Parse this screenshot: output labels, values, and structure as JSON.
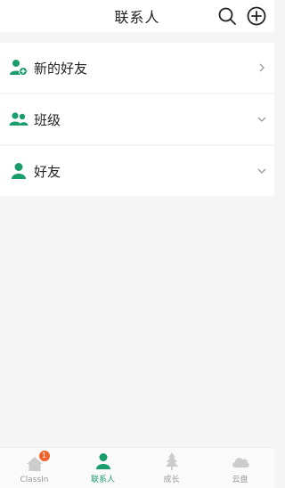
{
  "header": {
    "title": "联系人",
    "search_icon": "search-icon",
    "add_icon": "plus-circle-icon"
  },
  "rows": [
    {
      "label": "新的好友",
      "icon": "add-user-icon",
      "arrow": "chevron-right-icon"
    },
    {
      "label": "班级",
      "icon": "group-icon",
      "arrow": "chevron-down-icon"
    },
    {
      "label": "好友",
      "icon": "user-icon",
      "arrow": "chevron-down-icon"
    }
  ],
  "tabs": [
    {
      "label": "ClassIn",
      "icon": "home-icon",
      "badge": "1"
    },
    {
      "label": "联系人",
      "icon": "user-icon",
      "active": true
    },
    {
      "label": "成长",
      "icon": "tree-icon"
    },
    {
      "label": "云盘",
      "icon": "cloud-icon"
    }
  ],
  "colors": {
    "accent": "#1a9c6b",
    "badge": "#f0622a",
    "inactive_icon": "#cccccc"
  }
}
